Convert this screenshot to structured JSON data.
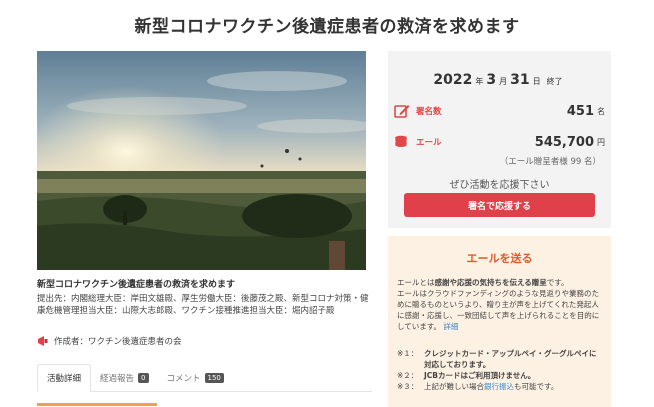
{
  "page": {
    "title": "新型コロナワクチン後遺症患者の救済を求めます"
  },
  "project": {
    "name": "新型コロナワクチン後遺症患者の救済を求めます",
    "submit_to": "提出先：内閣総理大臣：岸田文雄殿、厚生労働大臣：後藤茂之殿、新型コロナ対策・健康危機管理担当大臣：山際大志郎殿、ワクチン接種推進担当大臣：堀内詔子殿",
    "author": "作成者：ワクチン後遺症患者の会",
    "author_icon": "megaphone-icon"
  },
  "tabs": [
    {
      "label": "活動詳細"
    },
    {
      "label": "経過報告",
      "badge": "0"
    },
    {
      "label": "コメント",
      "badge": "150"
    }
  ],
  "status": {
    "year": "2022",
    "year_unit": "年",
    "month": "3",
    "month_unit": "月",
    "day": "31",
    "day_unit": "日",
    "end_label": "終了",
    "signatures_label": "署名数",
    "signatures_value": "451",
    "signatures_unit": "名",
    "signatures_icon": "pen-icon",
    "yell_label": "エール",
    "yell_value": "545,700",
    "yell_unit": "円",
    "yell_icon": "coins-icon",
    "supporters": "（エール贈呈者様 99 名）",
    "cta_text": "ぜひ活動を応援下さい",
    "cta_button": "署名で応援する",
    "accent_color": "#e0404a"
  },
  "yell": {
    "title": "エールを送る",
    "intro_1": "エールとは",
    "intro_bold": "感謝や応援の気持ちを伝える贈呈",
    "intro_2": "です。",
    "body": "エールはクラウドファンディングのような見返りや業務のために贈るものというより、贈り主が声を上げてくれた発起人に感謝・応援し、一致団結して声を上げられることを目的にしています。",
    "detail_link": "詳細",
    "notes": [
      {
        "mark": "※１：",
        "text": "クレジットカード・アップルペイ・グーグルペイに対応しております。"
      },
      {
        "mark": "※２：",
        "text": "JCBカードはご利用頂けません。"
      },
      {
        "mark": "※３：",
        "text_1": "上記が難しい場合",
        "link": "銀行振込",
        "text_2": "も可能です。"
      }
    ]
  }
}
